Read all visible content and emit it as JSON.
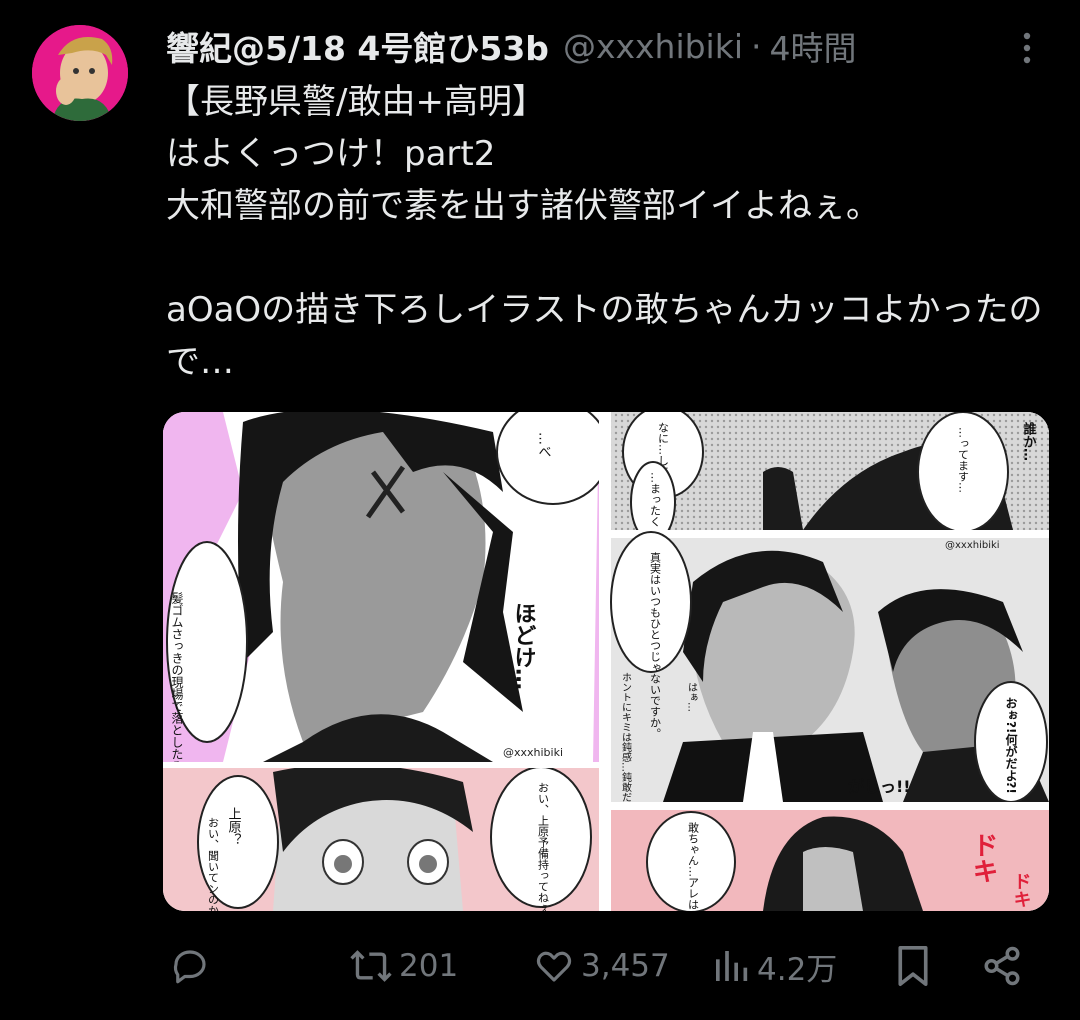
{
  "tweet": {
    "author_name": "響紀@5/18 4号館ひ53b",
    "handle": "@xxxhibiki",
    "separator": "·",
    "time": "4時間",
    "text": "【長野県警/敢由+高明】\nはよくっつけ！part2\n大和警部の前で素を出す諸伏警部イイよねぇ。\n\naOaOの描き下ろしイラストの敢ちゃんカッコよかったので…"
  },
  "manga": {
    "watermark": "@xxxhibiki",
    "panel1_bubble": "…べ",
    "panel1_speech": "髪ゴムさっきの現場で落としたみてぇだ…",
    "panel1_sfx": "ほどけ…",
    "panel2_lines": [
      "上原？",
      "おい、聞いてンのか？",
      "おい、上原予備持ってねぇか？"
    ],
    "panel3_lines": [
      "なに…してて",
      "…まったく",
      "…ってます…",
      "誰か…"
    ],
    "panel4_lines": [
      "真実はいつもひとつじゃないですか。",
      "ホントにキミは鈍感…鈍敢だ。",
      "はぁ…",
      "おぉ?!何がだよ?!",
      "がしっ!!"
    ],
    "panel5_lines": [
      "敢ちゃん…アレは目の毒だわ…",
      "ドキ",
      "ドキ"
    ]
  },
  "actions": {
    "reply_count": "",
    "retweet_count": "201",
    "like_count": "3,457",
    "view_count": "4.2万"
  },
  "colors": {
    "background": "#000000",
    "text": "#e7e9ea",
    "secondary": "#71767b",
    "avatar_bg": "#e6198a"
  },
  "icons": [
    "more-icon",
    "reply-icon",
    "retweet-icon",
    "like-icon",
    "views-icon",
    "bookmark-icon",
    "share-icon"
  ]
}
